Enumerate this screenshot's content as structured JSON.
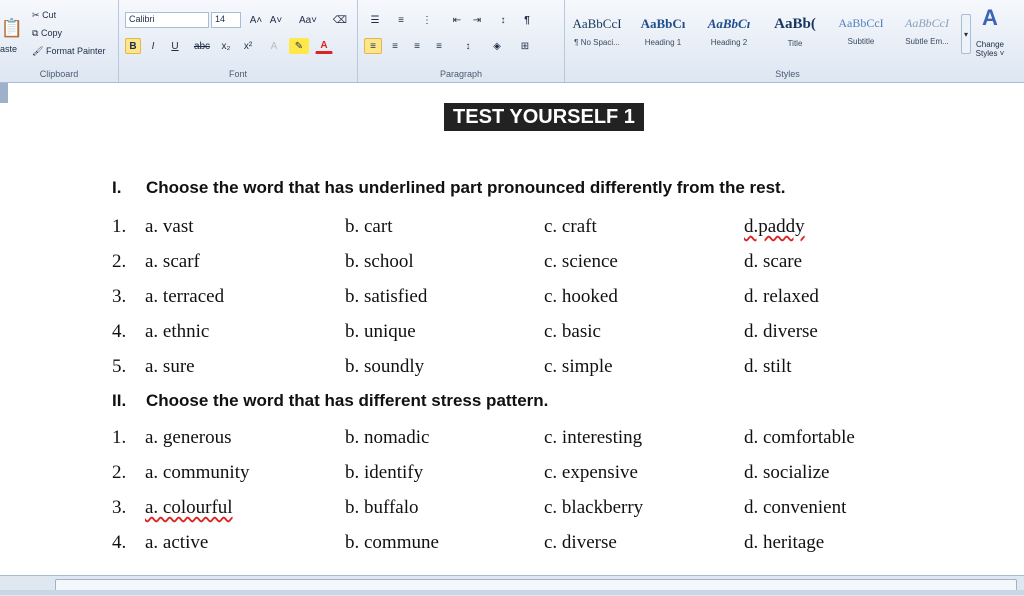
{
  "ribbon": {
    "clipboard": {
      "paste": "aste",
      "cut": "Cut",
      "copy": "Copy",
      "format_painter": "Format Painter",
      "label": "Clipboard"
    },
    "font": {
      "name": "Calibri",
      "size": "14",
      "grow": "A˄",
      "shrink": "A˅",
      "case": "Aa˅",
      "bold": "B",
      "italic": "I",
      "underline": "U",
      "strike": "abc",
      "sub": "x₂",
      "sup": "x²",
      "label": "Font"
    },
    "paragraph": {
      "label": "Paragraph"
    },
    "styles": {
      "label": "Styles",
      "items": [
        {
          "sample": "AaBbCcI",
          "name": "¶ No Spaci..."
        },
        {
          "sample": "AaBbCı",
          "name": "Heading 1"
        },
        {
          "sample": "AaBbCı",
          "name": "Heading 2"
        },
        {
          "sample": "AaBb(",
          "name": "Title"
        },
        {
          "sample": "AaBbCcI",
          "name": "Subtitle"
        },
        {
          "sample": "AaBbCcI",
          "name": "Subtle Em..."
        }
      ],
      "change_styles": "Change Styles ˅"
    }
  },
  "document": {
    "title": "TEST YOURSELF 1",
    "section1": {
      "num": "I.",
      "heading": "Choose the word that has underlined part pronounced differently from the rest."
    },
    "section1_questions": [
      {
        "num": "1.",
        "a": "a. vast",
        "b": "b. cart",
        "c": "c. craft",
        "d": "d.paddy"
      },
      {
        "num": "2.",
        "a": "a. scarf",
        "b": "b. school",
        "c": "c. science",
        "d": "d. scare"
      },
      {
        "num": "3.",
        "a": "a. terraced",
        "b": "b. satisfied",
        "c": "c. hooked",
        "d": "d. relaxed"
      },
      {
        "num": "4.",
        "a": "a. ethnic",
        "b": "b. unique",
        "c": "c. basic",
        "d": "d. diverse"
      },
      {
        "num": "5.",
        "a": "a. sure",
        "b": "b. soundly",
        "c": "c. simple",
        "d": "d. stilt"
      }
    ],
    "section2": {
      "num": "II.",
      "heading": "Choose the word that has different stress pattern."
    },
    "section2_questions": [
      {
        "num": "1.",
        "a": "a. generous",
        "b": "b. nomadic",
        "c": "c. interesting",
        "d": "d. comfortable"
      },
      {
        "num": "2.",
        "a": "a. community",
        "b": "b. identify",
        "c": "c. expensive",
        "d": "d. socialize"
      },
      {
        "num": "3.",
        "a": "a. colourful",
        "b": "b. buffalo",
        "c": "c. blackberry",
        "d": "d. convenient"
      },
      {
        "num": "4.",
        "a": "a. active",
        "b": "b. commune",
        "c": "c. diverse",
        "d": "d. heritage"
      }
    ]
  }
}
